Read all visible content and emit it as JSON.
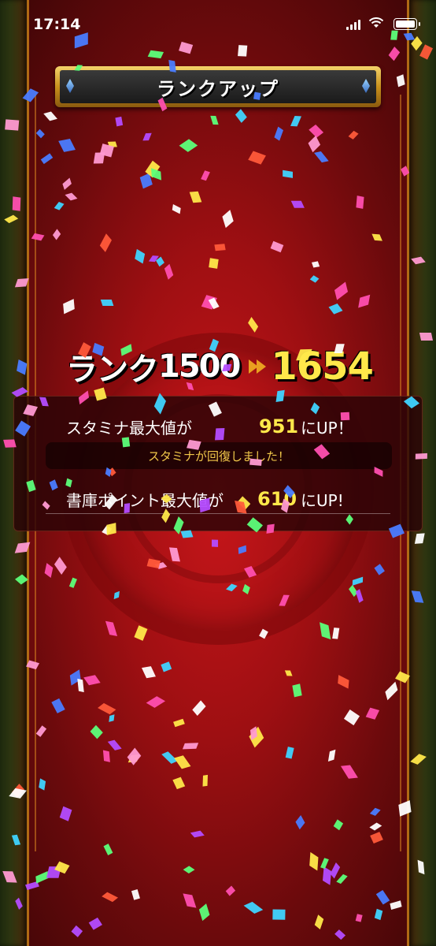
{
  "status_bar": {
    "time": "17:14"
  },
  "title": "ランクアップ",
  "rank": {
    "label": "ランク",
    "old": "1500",
    "new": "1654"
  },
  "stats": [
    {
      "label": "スタミナ最大値が",
      "value": "951",
      "suffix": "にUP！"
    },
    {
      "label": "書庫ポイント最大値が",
      "value": "610",
      "suffix": "にUP!"
    }
  ],
  "stamina_recovered": "スタミナが回復しました！",
  "colors": {
    "accent_gold": "#e9a020",
    "value_yellow": "#ffe84a",
    "background_red": "#9e0f12",
    "confetti": [
      "#ff4fb0",
      "#3fd4ff",
      "#ffe84a",
      "#b44cff",
      "#5cff7a",
      "#ff5a3a",
      "#ffffff",
      "#4a7cff",
      "#ff9ad2"
    ]
  }
}
